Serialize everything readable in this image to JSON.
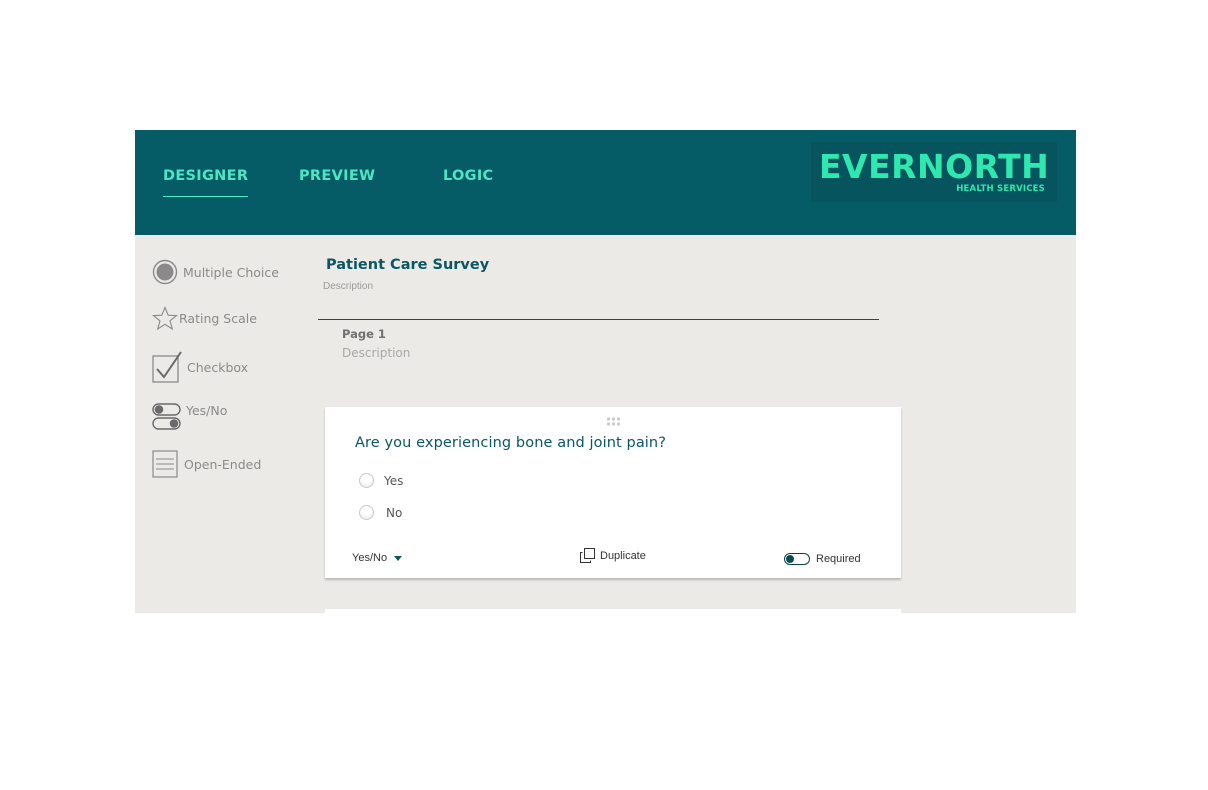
{
  "nav": {
    "tabs": [
      {
        "label": "DESIGNER",
        "active": true
      },
      {
        "label": "PREVIEW",
        "active": false
      },
      {
        "label": "LOGIC",
        "active": false
      }
    ],
    "logo": {
      "name": "EVERNORTH",
      "tagline": "HEALTH SERVICES"
    }
  },
  "toolbox": {
    "items": [
      {
        "label": "Multiple Choice",
        "icon": "radio-icon"
      },
      {
        "label": "Rating Scale",
        "icon": "star-icon"
      },
      {
        "label": "Checkbox",
        "icon": "checkbox-icon"
      },
      {
        "label": "Yes/No",
        "icon": "toggle-pair-icon"
      },
      {
        "label": "Open-Ended",
        "icon": "lines-icon"
      }
    ]
  },
  "survey": {
    "title": "Patient Care Survey",
    "description_placeholder": "Description",
    "page": {
      "label": "Page 1",
      "description_placeholder": "Description"
    }
  },
  "question": {
    "text": "Are you experiencing bone and joint pain?",
    "options": [
      "Yes",
      "No"
    ],
    "type_label": "Yes/No",
    "duplicate_label": "Duplicate",
    "required_label": "Required",
    "required": false
  },
  "colors": {
    "header_bg": "#055c66",
    "accent": "#4ee6c2",
    "logo_green": "#2ee8b0",
    "canvas_bg": "#ebeae6",
    "title_text": "#0b5663"
  }
}
